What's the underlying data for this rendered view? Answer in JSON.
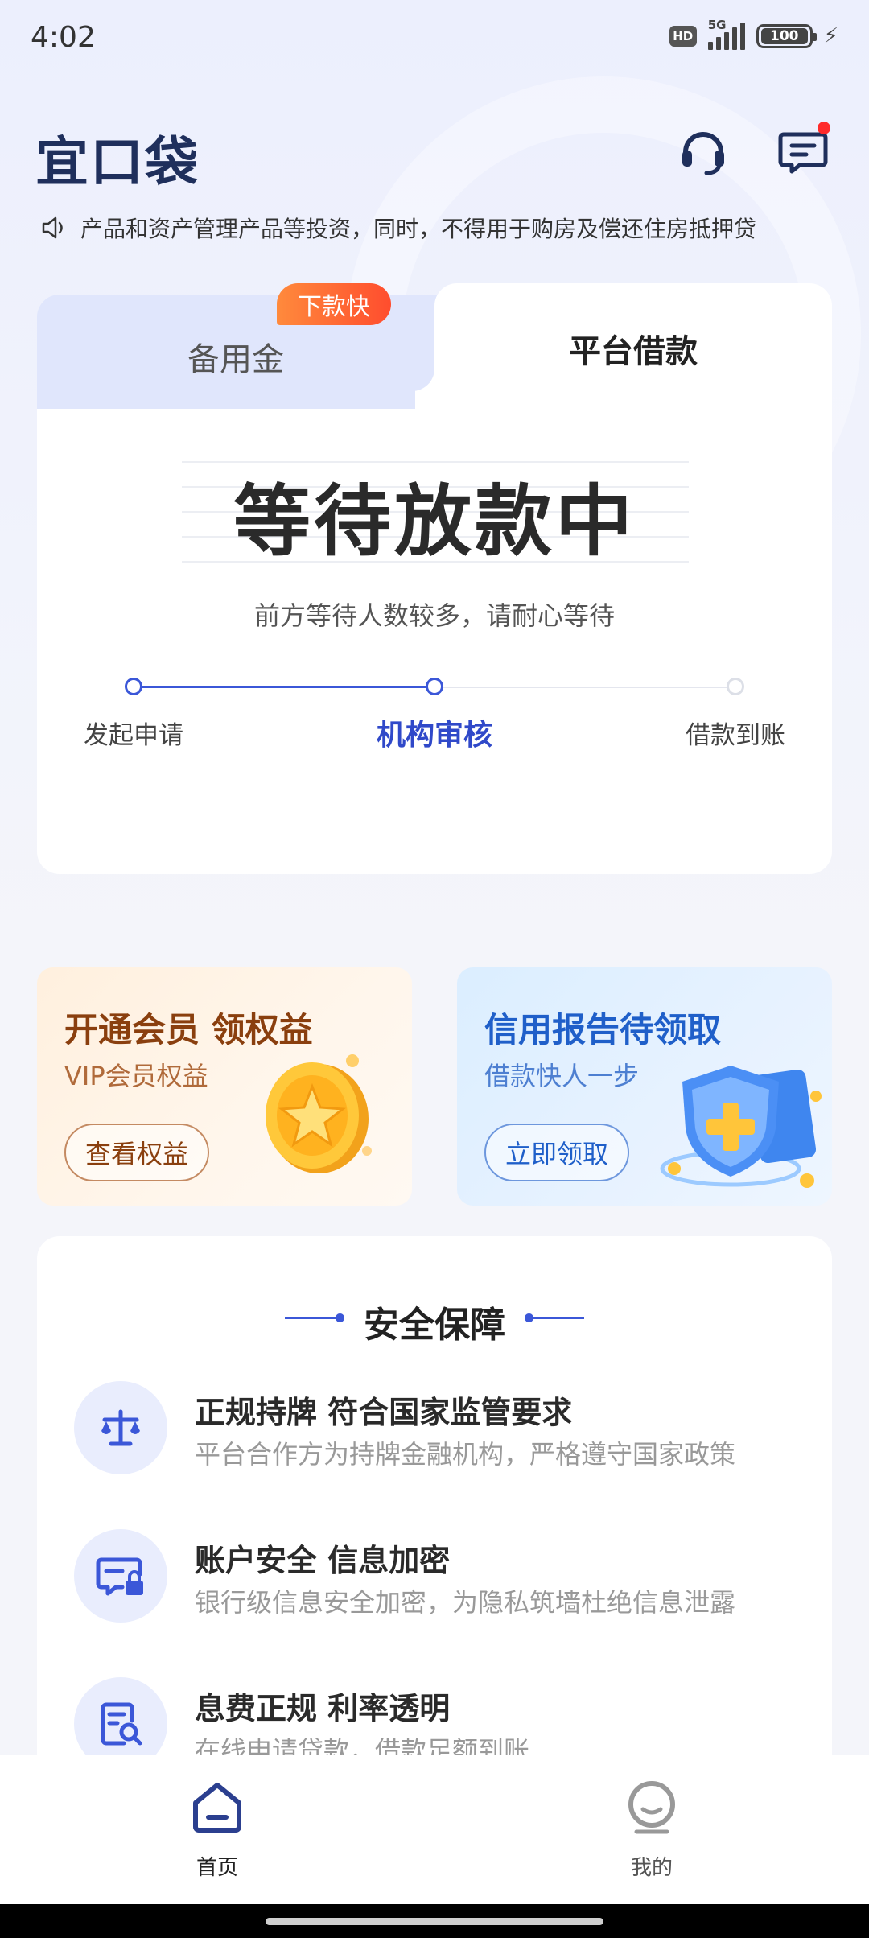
{
  "status_bar": {
    "time": "4:02",
    "hd": "HD",
    "network": "5G",
    "battery": "100"
  },
  "header": {
    "logo": "宜口袋"
  },
  "notice": {
    "text": "产品和资产管理产品等投资，同时，不得用于购房及偿还住房抵押贷"
  },
  "loan_card": {
    "tabs": [
      {
        "label": "备用金",
        "badge": "下款快",
        "active": false
      },
      {
        "label": "平台借款",
        "active": true
      }
    ],
    "status_title": "等待放款中",
    "status_subtitle": "前方等待人数较多，请耐心等待",
    "steps": [
      {
        "label": "发起申请",
        "state": "done"
      },
      {
        "label": "机构审核",
        "state": "current"
      },
      {
        "label": "借款到账",
        "state": "todo"
      }
    ]
  },
  "promos": [
    {
      "title": "开通会员 领权益",
      "subtitle": "VIP会员权益",
      "button": "查看权益"
    },
    {
      "title": "信用报告待领取",
      "subtitle": "借款快人一步",
      "button": "立即领取"
    }
  ],
  "safety": {
    "title": "安全保障",
    "items": [
      {
        "title": "正规持牌 符合国家监管要求",
        "desc": "平台合作方为持牌金融机构，严格遵守国家政策"
      },
      {
        "title": "账户安全 信息加密",
        "desc": "银行级信息安全加密，为隐私筑墙杜绝信息泄露"
      },
      {
        "title": "息费正规  利率透明",
        "desc": "在线申请贷款，借款足额到账"
      }
    ]
  },
  "bottom_nav": {
    "items": [
      {
        "label": "首页",
        "active": true
      },
      {
        "label": "我的",
        "active": false
      }
    ]
  },
  "colors": {
    "primary": "#3b57d8",
    "badge": "#ff5a30",
    "vip": "#8a3f0e",
    "credit": "#1f5fc9"
  }
}
